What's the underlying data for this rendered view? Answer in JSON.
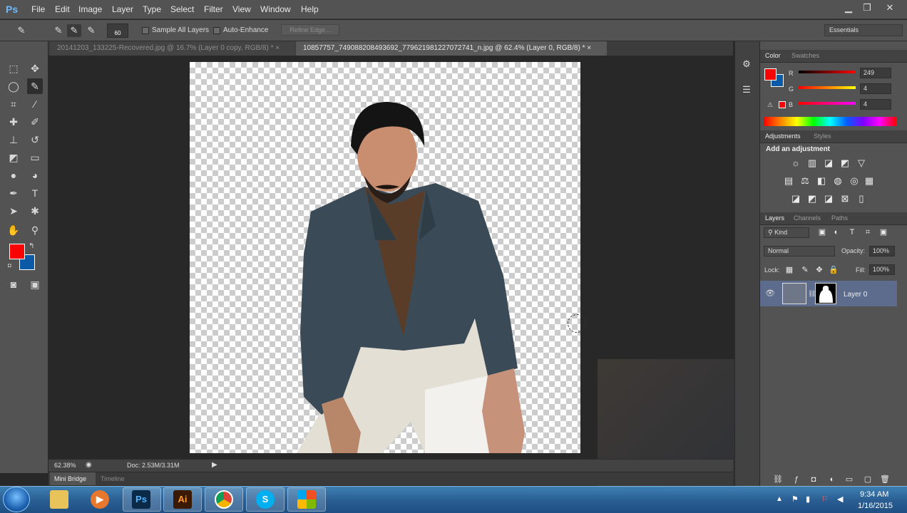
{
  "app": {
    "logo": "Ps"
  },
  "menu": [
    "File",
    "Edit",
    "Image",
    "Layer",
    "Type",
    "Select",
    "Filter",
    "View",
    "Window",
    "Help"
  ],
  "window_controls": {
    "minimize": "▁",
    "restore": "❐",
    "close": "✕"
  },
  "options_bar": {
    "brush_size": "60",
    "sample_all_layers": "Sample All Layers",
    "auto_enhance": "Auto-Enhance",
    "refine_edge": "Refine Edge...",
    "workspace": "Essentials"
  },
  "tabs": [
    {
      "label": "20141203_133225-Recovered.jpg @ 16.7% (Layer 0 copy, RGB/8) *",
      "close": "×"
    },
    {
      "label": "10857757_749088208493692_779621981227072741_n.jpg @ 62.4% (Layer 0, RGB/8) *",
      "close": "×"
    }
  ],
  "status": {
    "zoom": "62.38%",
    "doc": "Doc: 2.53M/3.31M"
  },
  "bottom_tabs": {
    "mini_bridge": "Mini Bridge",
    "timeline": "Timeline"
  },
  "color_panel": {
    "tabs": [
      "Color",
      "Swatches"
    ],
    "r_label": "R",
    "g_label": "G",
    "b_label": "B",
    "r": "249",
    "g": "4",
    "b": "4",
    "fg_color": "#f90404",
    "bg_color": "#0a5aa8"
  },
  "adjustments_panel": {
    "tabs": [
      "Adjustments",
      "Styles"
    ],
    "heading": "Add an adjustment"
  },
  "layers_panel": {
    "tabs": [
      "Layers",
      "Channels",
      "Paths"
    ],
    "kind": "Kind",
    "blend_mode": "Normal",
    "opacity_label": "Opacity:",
    "opacity": "100%",
    "lock_label": "Lock:",
    "fill_label": "Fill:",
    "fill": "100%",
    "layer_name": "Layer 0"
  },
  "taskbar": {
    "time": "9:34 AM",
    "date": "1/16/2015",
    "ps_label": "Ps",
    "ai_label": "Ai"
  }
}
